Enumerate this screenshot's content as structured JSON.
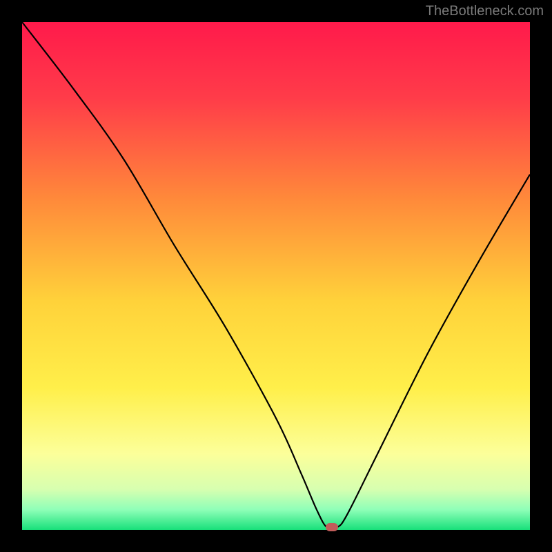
{
  "watermark": "TheBottleneck.com",
  "chart_data": {
    "type": "line",
    "title": "",
    "xlabel": "",
    "ylabel": "",
    "xlim": [
      0,
      100
    ],
    "ylim": [
      0,
      100
    ],
    "series": [
      {
        "name": "bottleneck-curve",
        "x": [
          0,
          10,
          20,
          30,
          40,
          50,
          55,
          58,
          60,
          62,
          64,
          70,
          80,
          90,
          100
        ],
        "y": [
          100,
          87,
          73,
          56,
          40,
          22,
          11,
          4,
          0.5,
          0.5,
          3,
          15,
          35,
          53,
          70
        ]
      }
    ],
    "marker": {
      "x": 61,
      "y": 0.5,
      "color": "#c15d5a"
    },
    "gradient_stops": [
      {
        "offset": 0.0,
        "color": "#ff1a4b"
      },
      {
        "offset": 0.15,
        "color": "#ff3c49"
      },
      {
        "offset": 0.35,
        "color": "#ff8a3a"
      },
      {
        "offset": 0.55,
        "color": "#ffd23a"
      },
      {
        "offset": 0.72,
        "color": "#ffef4a"
      },
      {
        "offset": 0.85,
        "color": "#fcff9a"
      },
      {
        "offset": 0.92,
        "color": "#d7ffb0"
      },
      {
        "offset": 0.96,
        "color": "#8fffb8"
      },
      {
        "offset": 1.0,
        "color": "#18e07a"
      }
    ]
  }
}
